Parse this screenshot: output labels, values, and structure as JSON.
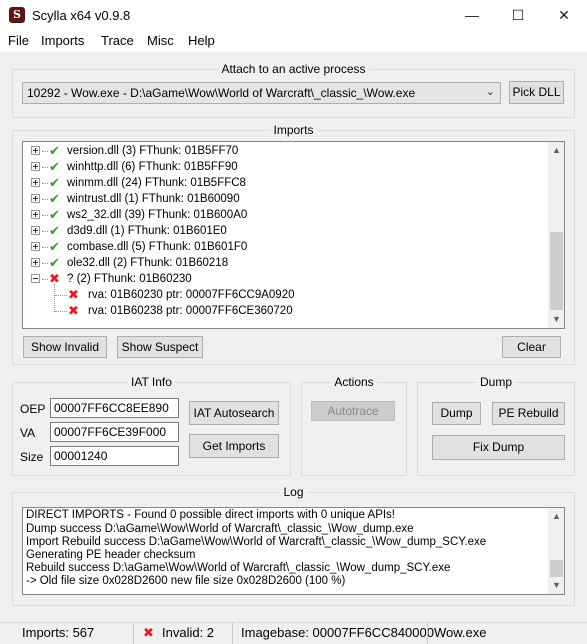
{
  "window": {
    "title": "Scylla x64 v0.9.8",
    "icon_letter": "S",
    "minimize": "—",
    "maximize": "☐",
    "close": "✕"
  },
  "menu": [
    "File",
    "Imports",
    "Trace",
    "Misc",
    "Help"
  ],
  "attach": {
    "title": "Attach to an active process",
    "process_value": "10292 - Wow.exe - D:\\aGame\\Wow\\World of Warcraft\\_classic_\\Wow.exe",
    "pick_dll": "Pick DLL"
  },
  "imports": {
    "title": "Imports",
    "tree": [
      {
        "text": "version.dll (3) FThunk: 01B5FF70",
        "status": "ok",
        "level": 0
      },
      {
        "text": "winhttp.dll (6) FThunk: 01B5FF90",
        "status": "ok",
        "level": 0
      },
      {
        "text": "winmm.dll (24) FThunk: 01B5FFC8",
        "status": "ok",
        "level": 0
      },
      {
        "text": "wintrust.dll (1) FThunk: 01B60090",
        "status": "ok",
        "level": 0
      },
      {
        "text": "ws2_32.dll (39) FThunk: 01B600A0",
        "status": "ok",
        "level": 0
      },
      {
        "text": "d3d9.dll (1) FThunk: 01B601E0",
        "status": "ok",
        "level": 0
      },
      {
        "text": "combase.dll (5) FThunk: 01B601F0",
        "status": "ok",
        "level": 0
      },
      {
        "text": "ole32.dll (2) FThunk: 01B60218",
        "status": "ok",
        "level": 0
      },
      {
        "text": "? (2) FThunk: 01B60230",
        "status": "bad",
        "level": 0,
        "expanded": true
      },
      {
        "text": "rva: 01B60230 ptr: 00007FF6CC9A0920",
        "status": "bad",
        "level": 1
      },
      {
        "text": "rva: 01B60238 ptr: 00007FF6CE360720",
        "status": "bad",
        "level": 1
      }
    ],
    "show_invalid": "Show Invalid",
    "show_suspect": "Show Suspect",
    "clear": "Clear"
  },
  "iat": {
    "title": "IAT Info",
    "oep_label": "OEP",
    "oep_value": "00007FF6CC8EE890",
    "va_label": "VA",
    "va_value": "00007FF6CE39F000",
    "size_label": "Size",
    "size_value": "00001240",
    "autosearch": "IAT Autosearch",
    "get_imports": "Get Imports"
  },
  "actions": {
    "title": "Actions",
    "autotrace": "Autotrace"
  },
  "dump": {
    "title": "Dump",
    "dump": "Dump",
    "pe_rebuild": "PE Rebuild",
    "fix_dump": "Fix Dump"
  },
  "log": {
    "title": "Log",
    "lines": [
      "DIRECT IMPORTS - Found 0 possible direct imports with 0 unique APIs!",
      "Dump success D:\\aGame\\Wow\\World of Warcraft\\_classic_\\Wow_dump.exe",
      "Import Rebuild success D:\\aGame\\Wow\\World of Warcraft\\_classic_\\Wow_dump_SCY.exe",
      "Generating PE header checksum",
      "Rebuild success D:\\aGame\\Wow\\World of Warcraft\\_classic_\\Wow_dump_SCY.exe",
      "-> Old file size 0x028D2600 new file size 0x028D2600 (100 %)"
    ]
  },
  "status": {
    "imports": "Imports: 567",
    "invalid": "Invalid: 2",
    "imagebase": "Imagebase: 00007FF6CC840000",
    "module": "Wow.exe"
  },
  "colors": {
    "ok": "#2f9e2f",
    "bad": "#e02020"
  }
}
